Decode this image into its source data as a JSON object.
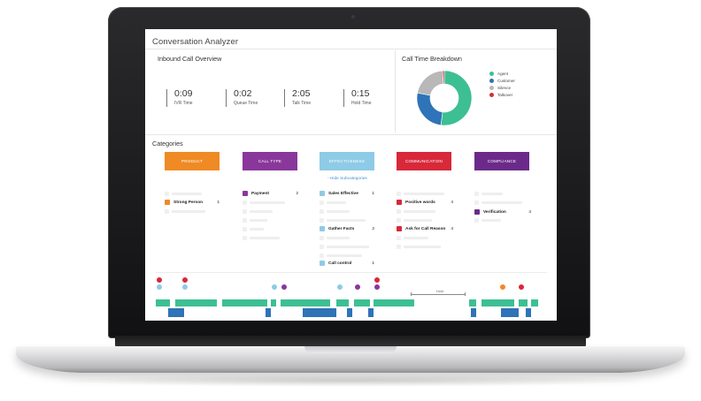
{
  "app": {
    "title": "Conversation Analyzer"
  },
  "overview": {
    "title": "Inbound Call Overview",
    "metrics": [
      {
        "value": "0:09",
        "label": "IVR Time"
      },
      {
        "value": "0:02",
        "label": "Queue Time"
      },
      {
        "value": "2:05",
        "label": "Talk Time"
      },
      {
        "value": "0:15",
        "label": "Hold Time"
      }
    ]
  },
  "breakdown": {
    "title": "Call Time Breakdown",
    "legend": [
      {
        "name": "Agent",
        "color": "#3dbf94"
      },
      {
        "name": "Customer",
        "color": "#2f73b8"
      },
      {
        "name": "Silence",
        "color": "#b8b8b8"
      },
      {
        "name": "Talkover",
        "color": "#d1313b"
      }
    ],
    "shares": [
      0.52,
      0.26,
      0.21,
      0.01
    ]
  },
  "categories": {
    "title": "Categories",
    "hide_link": "- Hide Subcategories",
    "buttons": [
      {
        "label": "PRODUCT",
        "color": "#ef8a25"
      },
      {
        "label": "CALL TYPE",
        "color": "#8a379b"
      },
      {
        "label": "EFFECTIVENESS",
        "color": "#8ecbe6"
      },
      {
        "label": "COMMUNICATION",
        "color": "#d8283a"
      },
      {
        "label": "COMPLIANCE",
        "color": "#6b2a8a"
      }
    ],
    "subcategories": [
      {
        "label": "Strong Person",
        "count": "1",
        "color": "#ef8a25"
      },
      {
        "label": "Payment",
        "count": "2",
        "color": "#8a379b"
      },
      {
        "label": "Sales Effective",
        "count": "1",
        "color": "#8ecbe6"
      },
      {
        "label": "Gather Facts",
        "count": "2",
        "color": "#8ecbe6"
      },
      {
        "label": "Call control",
        "count": "1",
        "color": "#8ecbe6"
      },
      {
        "label": "Positive words",
        "count": "4",
        "color": "#d8283a"
      },
      {
        "label": "Ask for Call Reason",
        "count": "4",
        "color": "#d8283a"
      },
      {
        "label": "Verification",
        "count": "4",
        "color": "#6b2a8a"
      }
    ]
  },
  "timeline": {
    "hold_label": "Hold",
    "agent_color": "#3dbf94",
    "customer_color": "#2f73b8"
  }
}
